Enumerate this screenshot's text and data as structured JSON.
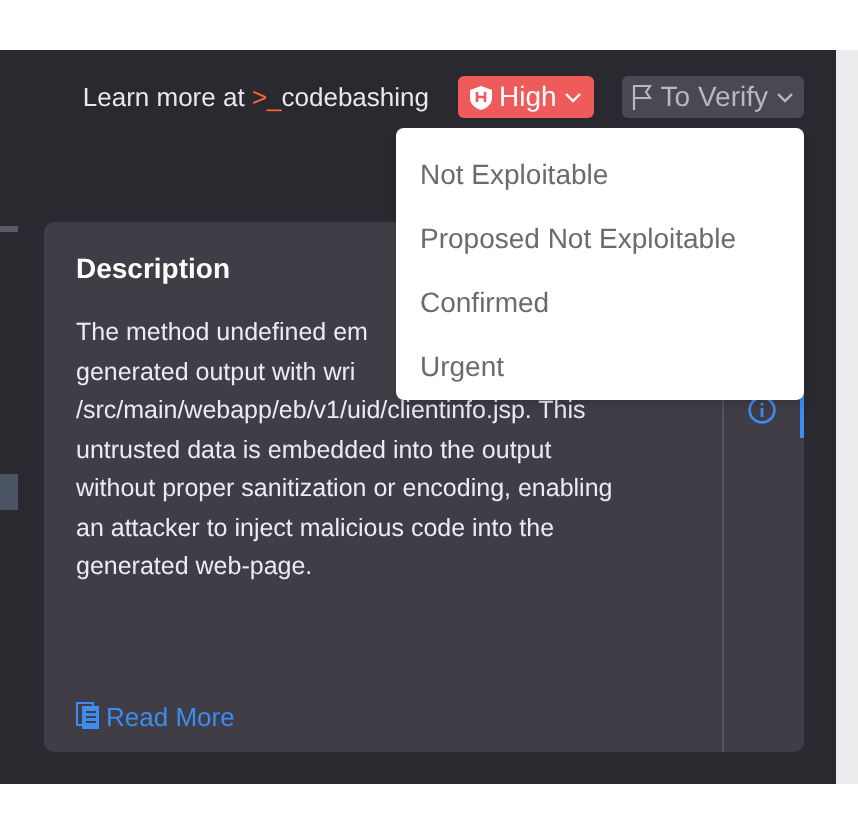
{
  "header": {
    "learn_more": "Learn more at",
    "brand_prefix": ">_",
    "brand": "codebashing",
    "severity": {
      "label": "High"
    },
    "state_button": {
      "label": "To Verify",
      "expanded": true
    }
  },
  "state_menu": [
    {
      "label": "Not Exploitable"
    },
    {
      "label": "Proposed Not Exploitable"
    },
    {
      "label": "Confirmed"
    },
    {
      "label": "Urgent"
    }
  ],
  "description": {
    "title": "Description",
    "lines": [
      "The method undefined em",
      "generated output with wri",
      "/src/main/webapp/eb/v1/uid/clientinfo.jsp. This",
      "untrusted data is embedded into the output",
      "without proper sanitization or encoding, enabling",
      "an attacker to inject malicious code into the",
      "generated web-page."
    ],
    "read_more": "Read More"
  }
}
